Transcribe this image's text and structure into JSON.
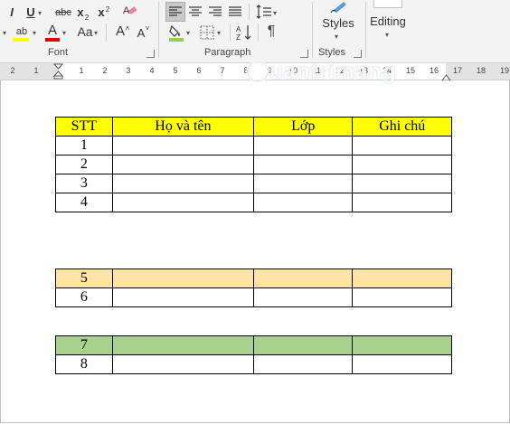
{
  "ribbon": {
    "font_group": {
      "label": "Font",
      "italic": "I",
      "underline": "U",
      "strikethrough": "abc",
      "subscript": "x",
      "subscript_mark": "2",
      "superscript": "x",
      "superscript_mark": "2",
      "highlight": "ab",
      "font_color": "A",
      "change_case": "Aa",
      "grow_font": "A",
      "shrink_font": "A"
    },
    "paragraph_group": {
      "label": "Paragraph",
      "sort": "A↓Z",
      "pilcrow": "¶"
    },
    "styles_group": {
      "label": "Styles",
      "button": "Styles"
    },
    "editing_group": {
      "button": "Editing"
    }
  },
  "ruler": {
    "left_numbers": [
      "2",
      "1"
    ],
    "right_numbers": [
      "1",
      "2",
      "3",
      "4",
      "5",
      "6",
      "7",
      "8",
      "9",
      "10",
      "11",
      "12",
      "13",
      "14",
      "15",
      "16",
      "17",
      "18",
      "19"
    ]
  },
  "watermark": "uantrimang",
  "table1": {
    "headers": [
      "STT",
      "Họ và tên",
      "Lớp",
      "Ghi chú"
    ],
    "rows": [
      "1",
      "2",
      "3",
      "4"
    ],
    "header_color": "#ffff00"
  },
  "table2": {
    "rows": [
      "5",
      "6"
    ],
    "highlight_color": "#ffe4a3"
  },
  "table3": {
    "rows": [
      "7",
      "8"
    ],
    "highlight_color": "#a9d18e"
  }
}
